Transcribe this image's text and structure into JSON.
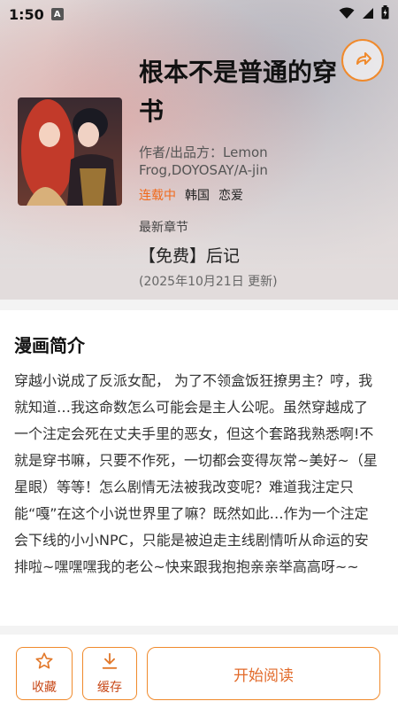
{
  "status_bar": {
    "time": "1:50",
    "badge": "A"
  },
  "comic": {
    "title": "根本不是普通的穿书",
    "author": "作者/出品方：Lemon Frog,DOYOSAY/A-jin",
    "status_tag": "连载中",
    "tags": [
      "韩国",
      "恋爱"
    ],
    "latest_label": "最新章节",
    "latest_chapter": "【免费】后记",
    "latest_date": "(2025年10月21日 更新)"
  },
  "synopsis": {
    "title": "漫画简介",
    "text": "穿越小说成了反派女配， 为了不领盒饭狂撩男主？哼，我就知道…我这命数怎么可能会是主人公呢。虽然穿越成了一个注定会死在丈夫手里的恶女，但这个套路我熟悉啊!不就是穿书嘛，只要不作死，一切都会变得灰常~美好~（星星眼）等等！怎么剧情无法被我改变呢？难道我注定只能“嘎”在这个小说世界里了嘛？既然如此…作为一个注定会下线的小小NPC，只能是被迫走主线剧情听从命运的安排啦~嘿嘿嘿我的老公~快来跟我抱抱亲亲举高高呀~~"
  },
  "actions": {
    "favorite_label": "收藏",
    "cache_label": "缓存",
    "read_label": "开始阅读"
  },
  "icons": {
    "share": "share-icon",
    "favorite": "star-icon",
    "cache": "download-icon",
    "wifi": "wifi-icon",
    "signal": "signal-icon",
    "battery": "battery-icon"
  },
  "colors": {
    "accent": "#f08a2c",
    "ongoing": "#f06a1c"
  }
}
